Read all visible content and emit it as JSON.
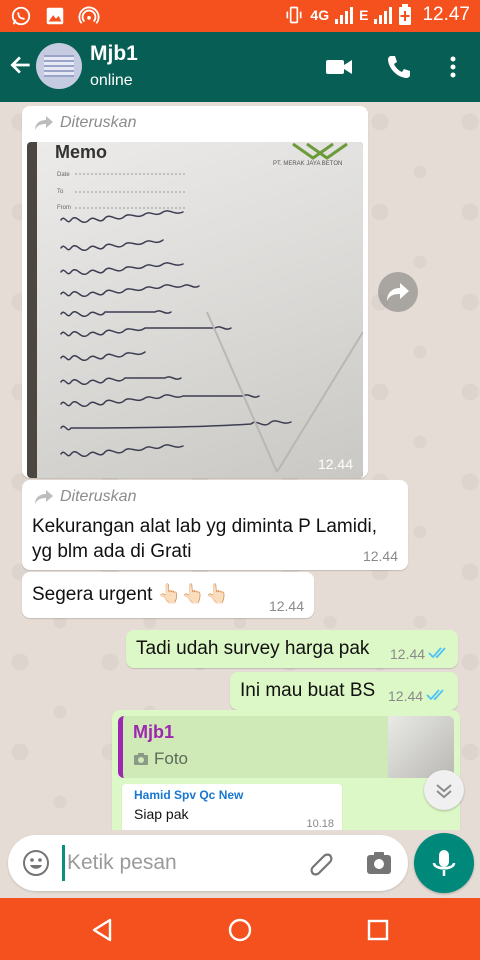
{
  "status_bar": {
    "network_type": "4G",
    "network_type_2": "E",
    "time": "12.47",
    "icons": [
      "whatsapp-icon",
      "gallery-icon",
      "hotspot-icon",
      "vibrate-icon",
      "signal-icon",
      "battery-icon"
    ]
  },
  "header": {
    "contact_name": "Mjb1",
    "status": "online",
    "icons": [
      "back-arrow-icon",
      "video-call-icon",
      "phone-icon",
      "more-vert-icon"
    ]
  },
  "messages": [
    {
      "type": "image",
      "direction": "in",
      "forwarded_label": "Diteruskan",
      "time": "12.44"
    },
    {
      "type": "text",
      "direction": "in",
      "forwarded_label": "Diteruskan",
      "line1": "Kekurangan alat lab yg diminta P Lamidi,",
      "line2": "yg blm ada di Grati",
      "time": "12.44"
    },
    {
      "type": "text",
      "direction": "in",
      "text": "Segera urgent 👆🏻👆🏻👆🏻",
      "time": "12.44"
    },
    {
      "type": "text",
      "direction": "out",
      "text": "Tadi udah survey harga pak",
      "time": "12.44",
      "status": "read"
    },
    {
      "type": "text",
      "direction": "out",
      "text": "Ini mau buat BS",
      "time": "12.44",
      "status": "read"
    },
    {
      "type": "reply",
      "direction": "out",
      "quoted_name": "Mjb1",
      "quoted_label": "Foto",
      "inner_sender": "Hamid Spv Qc New",
      "inner_text": "Siap pak",
      "inner_time": "10.18"
    }
  ],
  "composer": {
    "placeholder": "Ketik pesan"
  },
  "colors": {
    "status_bar": "#f4511e",
    "header": "#075e54",
    "outgoing_bubble": "#dcf8c6",
    "incoming_bubble": "#ffffff",
    "mic_button": "#00897b",
    "read_ticks": "#4fc3f7",
    "quote_accent": "#9c27b0"
  }
}
